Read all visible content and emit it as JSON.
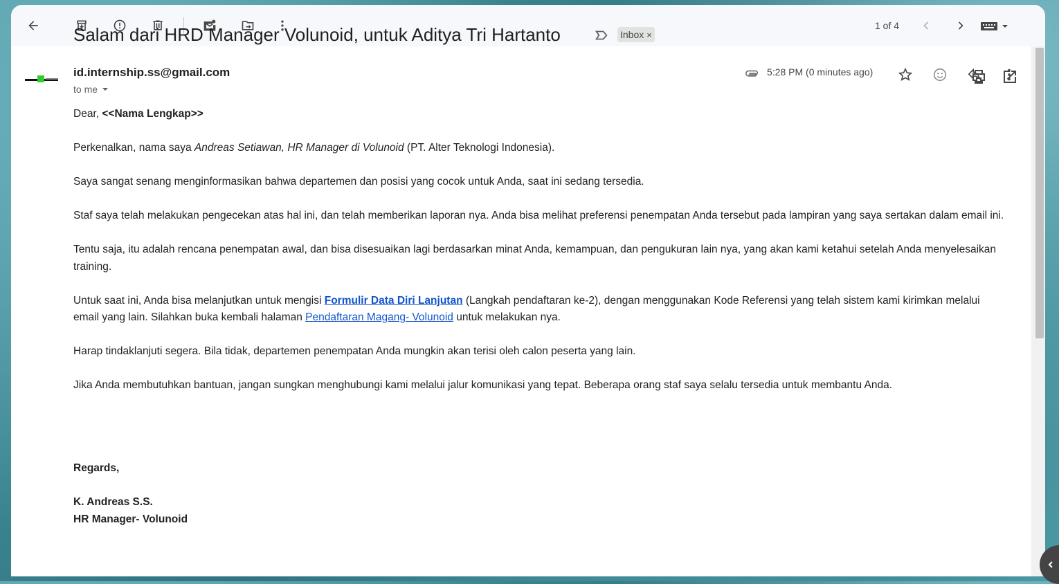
{
  "toolbar": {
    "icons": [
      "back-arrow-icon",
      "archive-icon",
      "report-spam-icon",
      "delete-icon",
      "mark-unread-icon",
      "move-to-icon",
      "more-vert-icon"
    ],
    "count": "1 of 4"
  },
  "email": {
    "subject": "Salam dari HRD Manager Volunoid, untuk Aditya Tri Hartanto",
    "label": "Inbox",
    "label_close": "×",
    "sender": "id.internship.ss@gmail.com",
    "to": "to me",
    "time": "5:28 PM (0 minutes ago)",
    "body": {
      "greeting_prefix": "Dear, ",
      "greeting_name": "<<Nama Lengkap>>",
      "p1_a": "Perkenalkan, nama saya ",
      "p1_italic": "Andreas Setiawan, HR Manager di Volunoid",
      "p1_b": " (PT. Alter Teknologi Indonesia).",
      "p2": "Saya sangat senang menginformasikan bahwa departemen dan posisi yang cocok untuk Anda, saat ini sedang tersedia.",
      "p3": "Staf saya telah melakukan pengecekan atas hal ini, dan telah memberikan laporan nya. Anda bisa melihat preferensi penempatan Anda tersebut pada lampiran yang saya sertakan dalam email ini.",
      "p4": "Tentu saja, itu adalah rencana penempatan awal, dan bisa disesuaikan lagi berdasarkan minat Anda, kemampuan, dan pengukuran lain nya, yang akan kami ketahui setelah Anda menyelesaikan training.",
      "p5_a": "Untuk saat ini, Anda bisa melanjutkan untuk mengisi ",
      "p5_link1": "Formulir Data Diri Lanjutan",
      "p5_b": " (Langkah pendaftaran ke-2), dengan menggunakan Kode Referensi yang telah sistem kami kirimkan melalui email yang lain. Silahkan buka kembali halaman ",
      "p5_link2": "Pendaftaran Magang- Volunoid",
      "p5_c": " untuk melakukan nya.",
      "p6": "Harap tindaklanjuti segera. Bila tidak, departemen penempatan Anda mungkin akan terisi oleh calon peserta yang lain.",
      "p7": "Jika Anda membutuhkan bantuan, jangan sungkan menghubungi kami melalui jalur komunikasi yang tepat. Beberapa orang staf saya selalu tersedia untuk membantu Anda."
    },
    "signature": {
      "regards": "Regards,",
      "name": "K. Andreas S.S.",
      "title": "HR Manager- Volunoid"
    }
  },
  "colors": {
    "link": "#1155cc",
    "toolbar_bg": "#f6f8fc"
  }
}
